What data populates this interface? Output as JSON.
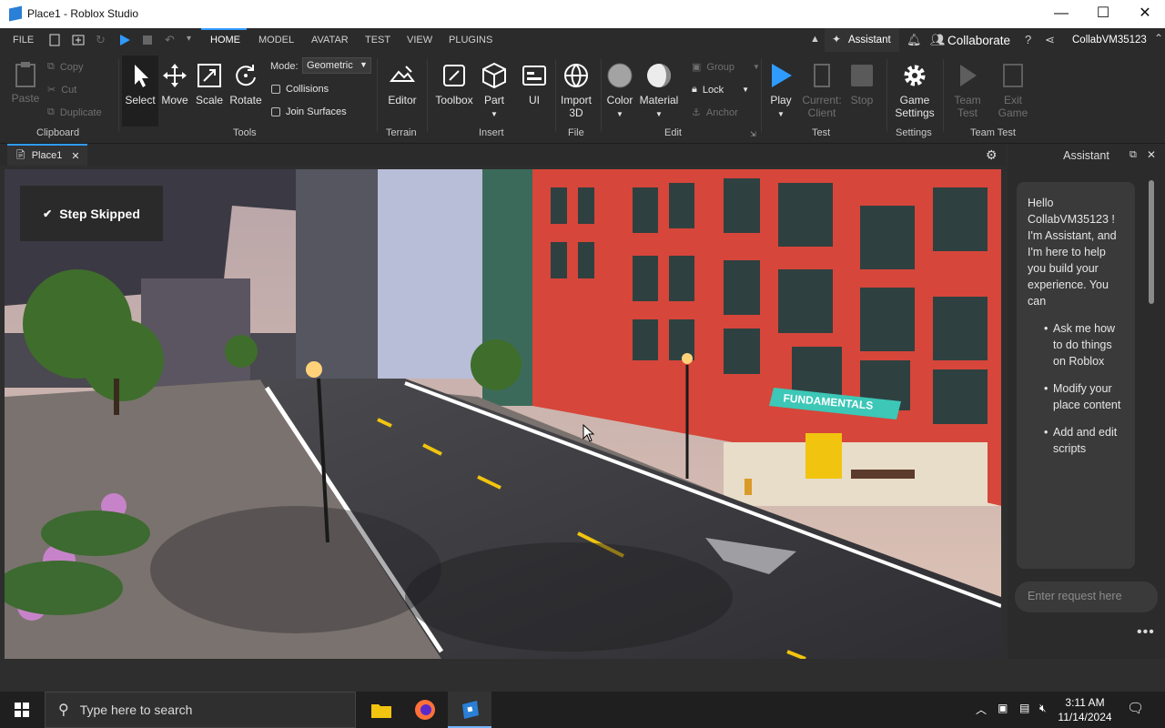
{
  "window": {
    "title": "Place1 - Roblox Studio",
    "minimize": "—",
    "maximize": "☐",
    "close": "✕"
  },
  "menubar": {
    "file": "FILE",
    "tabs": [
      "HOME",
      "MODEL",
      "AVATAR",
      "TEST",
      "VIEW",
      "PLUGINS"
    ],
    "active_tab": "HOME",
    "assistant_label": "Assistant",
    "collaborate_label": "Collaborate",
    "username": "CollabVM35123"
  },
  "ribbon": {
    "clipboard": {
      "paste": "Paste",
      "copy": "Copy",
      "cut": "Cut",
      "duplicate": "Duplicate",
      "group": "Clipboard"
    },
    "tools": {
      "select": "Select",
      "move": "Move",
      "scale": "Scale",
      "rotate": "Rotate",
      "mode_label": "Mode:",
      "mode_value": "Geometric",
      "collisions": "Collisions",
      "join_surfaces": "Join Surfaces",
      "group": "Tools"
    },
    "terrain": {
      "editor": "Editor",
      "group": "Terrain"
    },
    "insert": {
      "toolbox": "Toolbox",
      "part": "Part",
      "ui": "UI",
      "group": "Insert"
    },
    "file": {
      "import3d": "Import\n3D",
      "group": "File"
    },
    "edit": {
      "color": "Color",
      "material": "Material",
      "group_btn": "Group",
      "lock": "Lock",
      "anchor": "Anchor",
      "group": "Edit"
    },
    "test": {
      "play": "Play",
      "current_client": "Current:\nClient",
      "stop": "Stop",
      "group": "Test"
    },
    "settings": {
      "game_settings": "Game\nSettings",
      "group": "Settings"
    },
    "team_test": {
      "team_test": "Team\nTest",
      "exit_game": "Exit\nGame",
      "group": "Team Test"
    }
  },
  "doc_tab": {
    "label": "Place1"
  },
  "viewport": {
    "toast": "Step Skipped",
    "sign_text": "FUNDAMENTALS"
  },
  "assistant_panel": {
    "title": "Assistant",
    "intro": "Hello CollabVM35123 ! I'm Assistant, and I'm here to help you build your experience. You can",
    "bullets": [
      "Ask me how to do things on Roblox",
      "Modify your place content",
      "Add and edit scripts"
    ],
    "input_placeholder": "Enter request here",
    "more": "•••"
  },
  "taskbar": {
    "search_placeholder": "Type here to search",
    "time": "3:11 AM",
    "date": "11/14/2024"
  },
  "colors": {
    "accent": "#2f9bff",
    "brick": "#d84a3a",
    "sign": "#38c7b6"
  }
}
